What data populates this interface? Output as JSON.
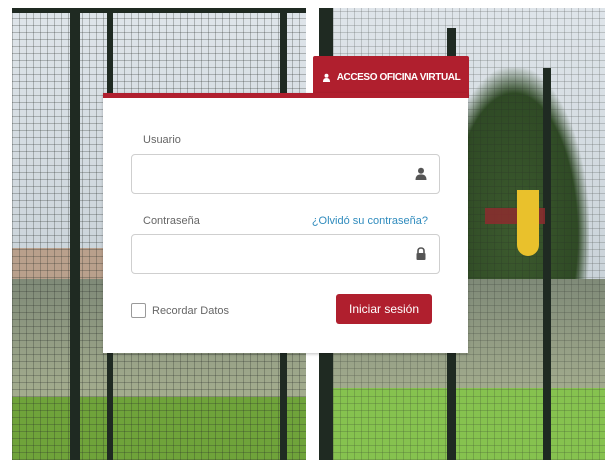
{
  "tab": {
    "label": "ACCESO OFICINA VIRTUAL",
    "icon": "user-icon"
  },
  "form": {
    "username_label": "Usuario",
    "username_value": "",
    "username_icon": "user-icon",
    "password_label": "Contraseña",
    "password_value": "",
    "password_icon": "lock-icon",
    "forgot_link": "¿Olvidó su contraseña?",
    "remember_label": "Recordar Datos",
    "remember_checked": false,
    "submit_label": "Iniciar sesión"
  },
  "colors": {
    "accent": "#b01f2e",
    "link": "#2f8bbd",
    "text_muted": "#666666",
    "border": "#cfcfcf"
  }
}
